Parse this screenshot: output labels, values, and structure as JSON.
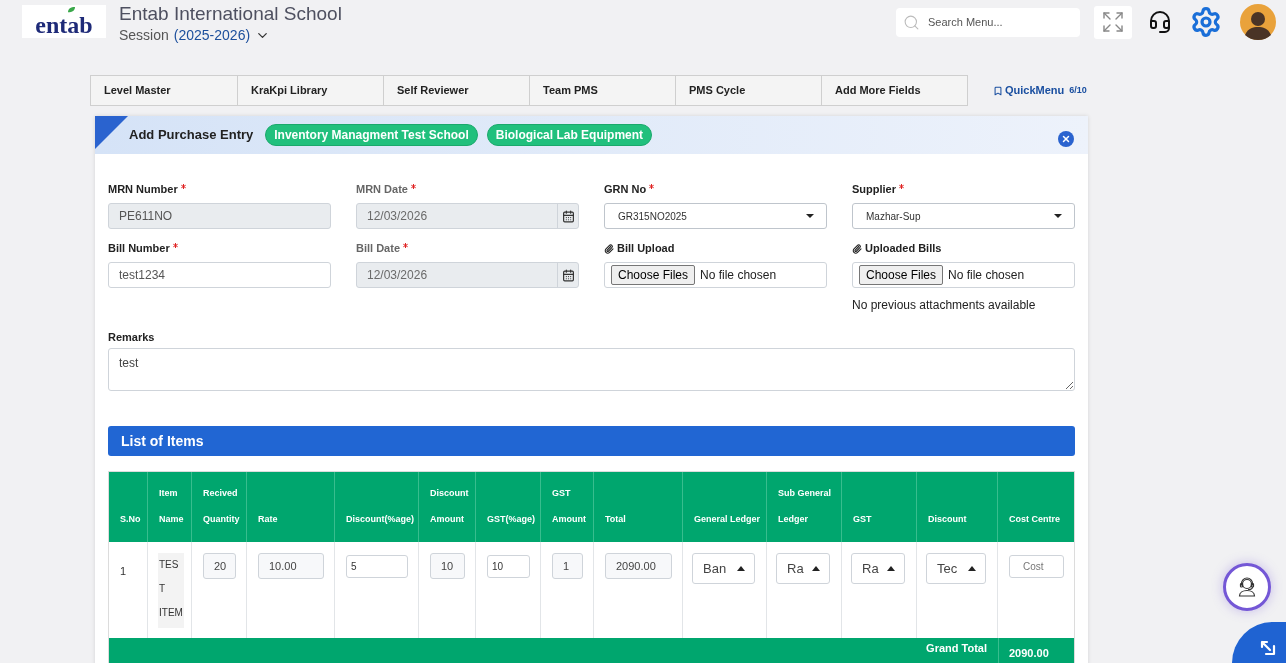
{
  "header": {
    "logo_text": "entab",
    "school_name": "Entab International School",
    "session": {
      "label": "Session",
      "value": "(2025-2026)"
    },
    "search": {
      "placeholder": "Search Menu..."
    }
  },
  "nav_tabs": [
    "Level Master",
    "KraKpi Library",
    "Self Reviewer",
    "Team PMS",
    "PMS Cycle",
    "Add More Fields"
  ],
  "quick_menu": {
    "label": "QuickMenu",
    "count": "6/10"
  },
  "panel": {
    "title": "Add Purchase Entry",
    "tags": [
      "Inventory Managment Test School",
      "Biological Lab Equipment"
    ]
  },
  "form": {
    "fields": [
      {
        "kind": "text",
        "label": "MRN Number",
        "required": true,
        "disabled": true,
        "value": "PE611NO"
      },
      {
        "kind": "date",
        "label": "MRN Date",
        "required": true,
        "disabled": true,
        "value": "12/03/2026"
      },
      {
        "kind": "select",
        "label": "GRN No",
        "required": true,
        "disabled": false,
        "value": "GR315NO2025"
      },
      {
        "kind": "select",
        "label": "Supplier",
        "required": true,
        "disabled": false,
        "value": "Mazhar-Sup"
      },
      {
        "kind": "text",
        "label": "Bill Number",
        "required": true,
        "disabled": false,
        "value": "test1234"
      },
      {
        "kind": "date",
        "label": "Bill Date",
        "required": true,
        "disabled": true,
        "value": "12/03/2026"
      },
      {
        "kind": "file",
        "label": "Bill Upload",
        "required": false,
        "disabled": false,
        "button": "Choose Files",
        "status": "No file chosen"
      },
      {
        "kind": "file",
        "label": "Uploaded Bills",
        "required": false,
        "disabled": false,
        "button": "Choose Files",
        "status": "No file chosen",
        "note": "No previous attachments available"
      }
    ]
  },
  "remarks": {
    "label": "Remarks",
    "value": "test"
  },
  "items": {
    "title": "List of Items",
    "columns": [
      "S.No",
      "Item Name",
      "Recived Quantity",
      "Rate",
      "Discount(%age)",
      "Discount Amount",
      "GST(%age)",
      "GST Amount",
      "Total",
      "General Ledger",
      "Sub General Ledger",
      "GST",
      "Discount",
      "Cost Centre"
    ],
    "rows": [
      {
        "cells": [
          {
            "kind": "text",
            "value": "1"
          },
          {
            "kind": "block",
            "value": "TEST ITEM"
          },
          {
            "kind": "readonly",
            "value": "20"
          },
          {
            "kind": "readonly",
            "value": "10.00"
          },
          {
            "kind": "input",
            "value": "5"
          },
          {
            "kind": "readonly",
            "value": "10"
          },
          {
            "kind": "input",
            "value": "10"
          },
          {
            "kind": "readonly",
            "value": "1"
          },
          {
            "kind": "readonly",
            "value": "2090.00"
          },
          {
            "kind": "select",
            "value": "Ban"
          },
          {
            "kind": "select",
            "value": "Ra"
          },
          {
            "kind": "select",
            "value": "Ra"
          },
          {
            "kind": "select",
            "value": "Tec"
          },
          {
            "kind": "input",
            "placeholder": "Cost"
          }
        ]
      }
    ],
    "footer": {
      "label": "Grand Total",
      "value": "2090.00"
    }
  }
}
